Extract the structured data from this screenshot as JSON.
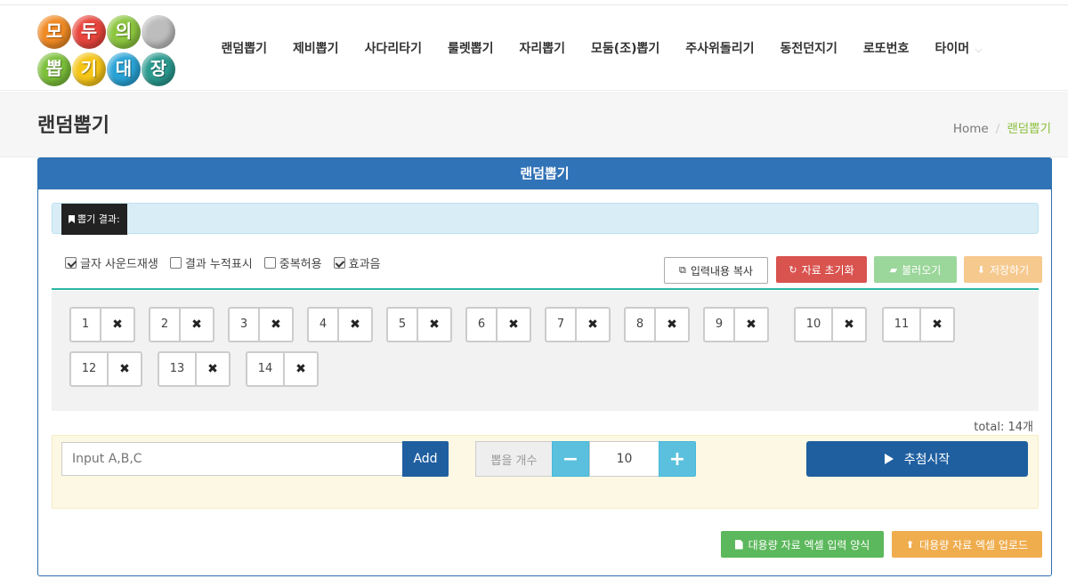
{
  "logo": {
    "balls": [
      {
        "char": "모",
        "color": "#f08a24"
      },
      {
        "char": "두",
        "color": "#e8453c"
      },
      {
        "char": "의",
        "color": "#8cc63f"
      },
      {
        "char": "",
        "color": "#bdbdbd"
      },
      {
        "char": "뽑",
        "color": "#7bbf3a"
      },
      {
        "char": "기",
        "color": "#f5c518"
      },
      {
        "char": "대",
        "color": "#29a3d6"
      },
      {
        "char": "장",
        "color": "#2a9a8f"
      }
    ]
  },
  "nav": {
    "items": [
      "랜덤뽑기",
      "제비뽑기",
      "사다리타기",
      "룰렛뽑기",
      "자리뽑기",
      "모둠(조)뽑기",
      "주사위돌리기",
      "동전던지기",
      "로또번호",
      "타이머"
    ],
    "dropdown_icon": "chevron-down-icon"
  },
  "page": {
    "title": "랜덤뽑기",
    "breadcrumb": {
      "home": "Home",
      "current": "랜덤뽑기"
    }
  },
  "panel": {
    "title": "랜덤뽑기",
    "result_label": "뽑기 결과:",
    "options": [
      {
        "label": "글자 사운드재생",
        "checked": true
      },
      {
        "label": "결과 누적표시",
        "checked": false
      },
      {
        "label": "중복허용",
        "checked": false
      },
      {
        "label": "효과음",
        "checked": true
      }
    ],
    "buttons": {
      "copy": "입력내용 복사",
      "reset": "자료 초기화",
      "load": "불러오기",
      "save": "저장하기"
    },
    "items": [
      "1",
      "2",
      "3",
      "4",
      "5",
      "6",
      "7",
      "8",
      "9",
      "10",
      "11",
      "12",
      "13",
      "14"
    ],
    "remove_icon": "✖",
    "total": "total: 14개",
    "input": {
      "placeholder": "Input A,B,C",
      "add_label": "Add"
    },
    "counter": {
      "label": "뽑을 개수",
      "minus": "−",
      "plus": "+",
      "value": "10"
    },
    "start_label": "추첨시작",
    "excel": {
      "form_label": "대용량 자료 엑셀 입력 양식",
      "upload_label": "대용량 자료 엑셀 업로드"
    }
  },
  "colors": {
    "panel_head": "#3173b7",
    "accent_teal": "#2bb7a5",
    "danger": "#d9534f",
    "success": "#5cb85c",
    "warning": "#f0ad4e",
    "primary": "#1f5fa0",
    "info": "#5bc0de"
  }
}
